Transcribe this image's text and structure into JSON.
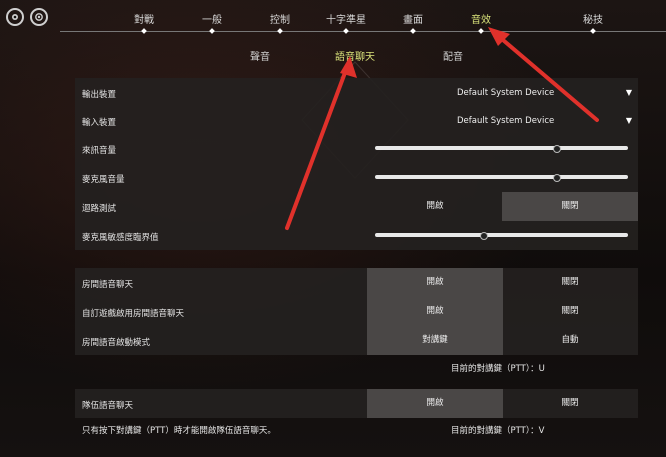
{
  "top_icons": [
    {
      "name": "settings-gear-icon"
    },
    {
      "name": "profile-badge-icon"
    }
  ],
  "nav": {
    "tabs": [
      {
        "label": "對戰"
      },
      {
        "label": "一般"
      },
      {
        "label": "控制"
      },
      {
        "label": "十字準星"
      },
      {
        "label": "畫面"
      },
      {
        "label": "音效",
        "active": true
      },
      {
        "label": "秘技"
      }
    ]
  },
  "sub_tabs": [
    {
      "label": "聲音"
    },
    {
      "label": "語音聊天",
      "active": true
    },
    {
      "label": "配音"
    }
  ],
  "devices": {
    "output_label": "輸出裝置",
    "output_value": "Default System Device",
    "input_label": "輸入裝置",
    "input_value": "Default System Device",
    "incoming_volume_label": "來訊音量",
    "incoming_volume_level": 0.72,
    "mic_volume_label": "麥克風音量",
    "mic_volume_level": 0.72,
    "loopback_label": "迴路測試",
    "loopback_on": "開啟",
    "loopback_off": "關閉",
    "mic_threshold_label": "麥克風敏感度臨界值",
    "mic_threshold_level": 0.43
  },
  "party": {
    "party_voice_label": "房間語音聊天",
    "party_voice_on": "開啟",
    "party_voice_off": "關閉",
    "custom_voice_label": "自訂遊戲啟用房間語音聊天",
    "custom_voice_on": "開啟",
    "custom_voice_off": "關閉",
    "activation_label": "房間語音啟動模式",
    "activation_ptt": "對講鍵",
    "activation_auto": "自動",
    "current_ptt": "目前的對講鍵（PTT）：U"
  },
  "team": {
    "team_voice_label": "隊伍語音聊天",
    "team_voice_on": "開啟",
    "team_voice_off": "關閉",
    "note": "只有按下對講鍵（PTT）時才能開啟隊伍語音聊天。",
    "current_ptt": "目前的對講鍵（PTT）：V"
  },
  "colors": {
    "accent": "#d9e27a",
    "annotation_arrow": "#e0312b",
    "selected_option": "#4a4746"
  }
}
